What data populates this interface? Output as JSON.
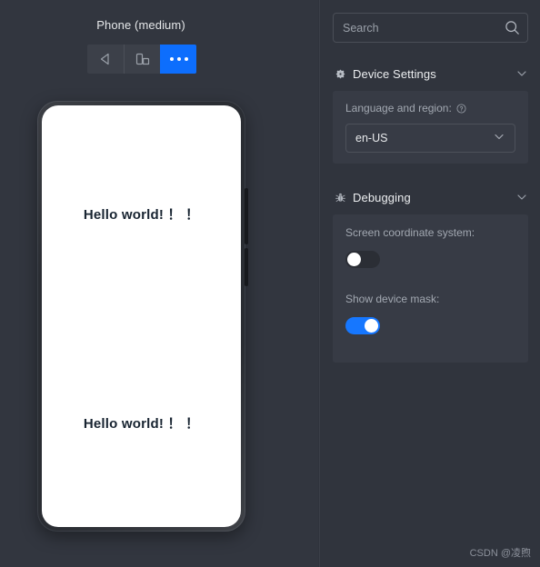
{
  "preview": {
    "device_title": "Phone (medium)",
    "toolbar": [
      {
        "name": "back-button",
        "icon": "triangle-left-icon",
        "active": false
      },
      {
        "name": "rotate-button",
        "icon": "device-rotate-icon",
        "active": false
      },
      {
        "name": "more-options-button",
        "icon": "ellipsis-icon",
        "active": true
      }
    ],
    "screen_texts": [
      "Hello world!  ！ ！",
      "Hello world!  ！ ！"
    ]
  },
  "settings": {
    "search": {
      "placeholder": "Search",
      "value": "",
      "icon": "search-icon"
    },
    "sections": [
      {
        "id": "device-settings",
        "icon": "gear-icon",
        "title": "Device Settings",
        "expanded": true,
        "fields": [
          {
            "type": "select",
            "label": "Language and region:",
            "has_help": true,
            "value": "en-US",
            "options": [
              "en-US"
            ]
          }
        ]
      },
      {
        "id": "debugging",
        "icon": "bug-icon",
        "title": "Debugging",
        "expanded": true,
        "fields": [
          {
            "type": "toggle",
            "label": "Screen coordinate system:",
            "value": false
          },
          {
            "type": "toggle",
            "label": "Show device mask:",
            "value": true
          }
        ]
      }
    ]
  },
  "watermark": "CSDN @凌煦",
  "colors": {
    "accent": "#0d6efd",
    "toggle_on": "#1677ff",
    "pane_bg": "#32363f",
    "settings_bg": "#30343d",
    "card_bg": "#373b45",
    "screen_bg": "#ffffff",
    "text_primary": "#eceef0",
    "text_secondary": "#a2a8b1"
  }
}
